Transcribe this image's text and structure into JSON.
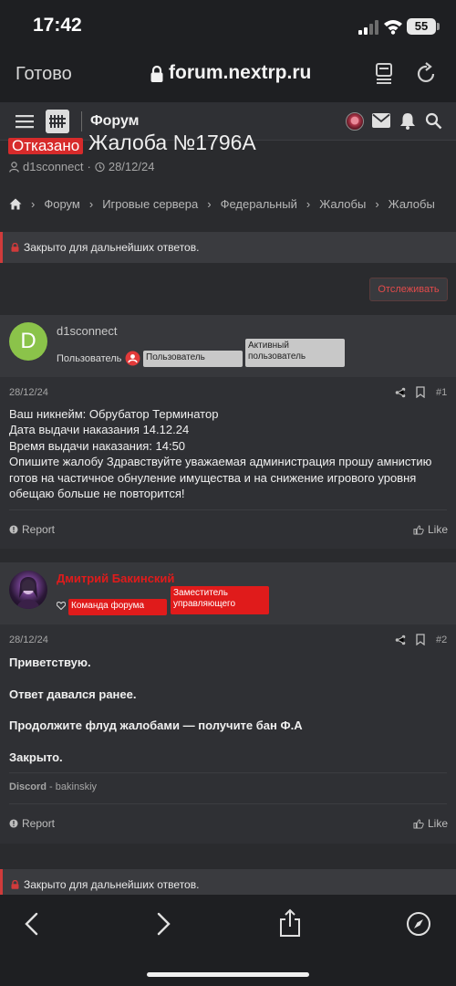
{
  "status_bar": {
    "time": "17:42",
    "battery": "55"
  },
  "browser": {
    "done_label": "Готово",
    "url": "forum.nextrp.ru"
  },
  "forum_nav": {
    "title": "Форум"
  },
  "thread": {
    "status": "Отказано",
    "title": "Жалоба №1796А",
    "author": "d1sconnect",
    "date": "28/12/24"
  },
  "breadcrumb": [
    "Форум",
    "Игровые сервера",
    "Федеральный",
    "Жалобы",
    "Жалобы"
  ],
  "closed_notice": "Закрыто для дальнейших ответов.",
  "watch_label": "Отслеживать",
  "posts": [
    {
      "avatar_letter": "D",
      "username": "d1sconnect",
      "user_title": "Пользователь",
      "badges": [
        "Пользователь",
        "Активный пользователь"
      ],
      "date": "28/12/24",
      "number": "#1",
      "lines": [
        "Ваш никнейм: Обрубатор Терминатор",
        "Дата выдачи наказания 14.12.24",
        "Время выдачи наказания: 14:50",
        "Опишите жалобу Здравствуйте уважаемая администрация прошу амнистию",
        "готов на частичное обнуление имущества и на снижение игрового уровня",
        "обещаю больше не повторится!"
      ],
      "report_label": "Report",
      "like_label": "Like"
    },
    {
      "username": "Дмитрий Бакинский",
      "badges": [
        "Команда форума",
        "Заместитель управляющего"
      ],
      "date": "28/12/24",
      "number": "#2",
      "paragraphs": [
        "Приветствую.",
        "Ответ давался ранее.",
        "Продолжите флуд жалобами — получите бан Ф.А",
        "Закрыто."
      ],
      "signature_label": "Discord",
      "signature_value": "bakinskiy",
      "report_label": "Report",
      "like_label": "Like"
    }
  ],
  "colors": {
    "accent_red": "#d72b2b",
    "avatar_green": "#8bc34a",
    "background": "#2a2b2e"
  }
}
